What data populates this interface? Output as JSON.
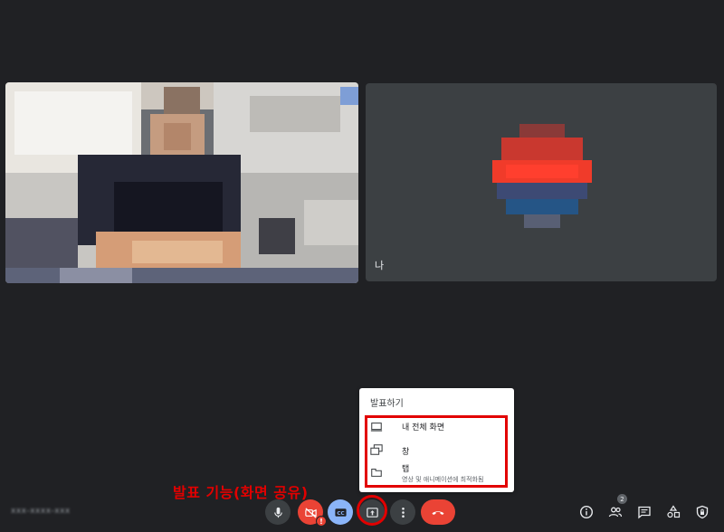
{
  "tiles": {
    "self_name": "나"
  },
  "meeting_id": "xxx-xxxx-xxx",
  "present_menu": {
    "title": "발표하기",
    "options": [
      {
        "label": "내 전체 화면",
        "icon": "monitor-icon"
      },
      {
        "label": "창",
        "icon": "windows-icon"
      },
      {
        "label": "탭",
        "sublabel": "영상 및 애니메이션에 최적화됨",
        "icon": "tab-icon"
      }
    ]
  },
  "annotation": "발표 기능(화면 공유)",
  "controls": {
    "camera_warning": "!",
    "participant_count": "2"
  },
  "colors": {
    "background": "#202124",
    "danger": "#ea4335",
    "captions": "#8ab4f8",
    "annotation": "#e20000"
  }
}
